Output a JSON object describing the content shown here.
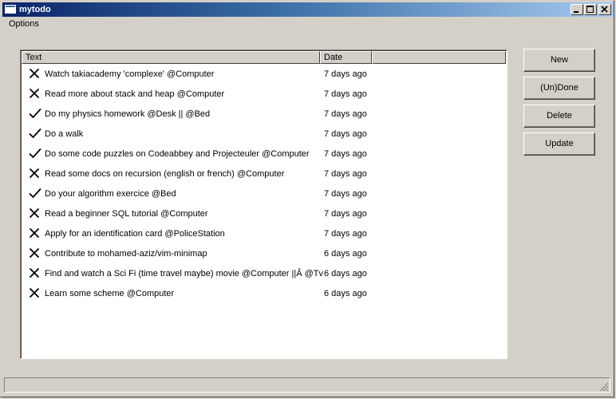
{
  "window": {
    "title": "mytodo"
  },
  "menu": {
    "options_label": "Options"
  },
  "table": {
    "columns": [
      "Text",
      "Date"
    ],
    "rows": [
      {
        "text": "Watch takiacademy 'complexe' @Computer",
        "date": "7 days ago",
        "status": "x-icon"
      },
      {
        "text": "Read more about stack and heap @Computer",
        "date": "7 days ago",
        "status": "x-icon"
      },
      {
        "text": "Do my physics homework @Desk || @Bed",
        "date": "7 days ago",
        "status": "check-icon"
      },
      {
        "text": "Do a walk",
        "date": "7 days ago",
        "status": "check-icon"
      },
      {
        "text": "Do some code puzzles on Codeabbey and Projecteuler @Computer",
        "date": "7 days ago",
        "status": "check-icon"
      },
      {
        "text": "Read some docs on recursion (english or french) @Computer",
        "date": "7 days ago",
        "status": "x-icon"
      },
      {
        "text": "Do your algorithm exercice @Bed",
        "date": "7 days ago",
        "status": "check-icon"
      },
      {
        "text": "Read a beginner SQL tutorial @Computer",
        "date": "7 days ago",
        "status": "x-icon"
      },
      {
        "text": "Apply for an identification card @PoliceStation",
        "date": "7 days ago",
        "status": "x-icon"
      },
      {
        "text": "Contribute to mohamed-aziz/vim-minimap",
        "date": "6 days ago",
        "status": "x-icon"
      },
      {
        "text": "Find and watch a Sci Fi (time travel maybe) movie @Computer ||Â @Tv",
        "date": "6 days ago",
        "status": "x-icon"
      },
      {
        "text": "Learn some scheme @Computer",
        "date": "6 days ago",
        "status": "x-icon"
      }
    ]
  },
  "buttons": {
    "new_label": "New",
    "undone_label": "(Un)Done",
    "delete_label": "Delete",
    "update_label": "Update"
  },
  "colors": {
    "title_start": "#0a246a",
    "title_end": "#a6caf0",
    "face": "#d4d0c8"
  }
}
